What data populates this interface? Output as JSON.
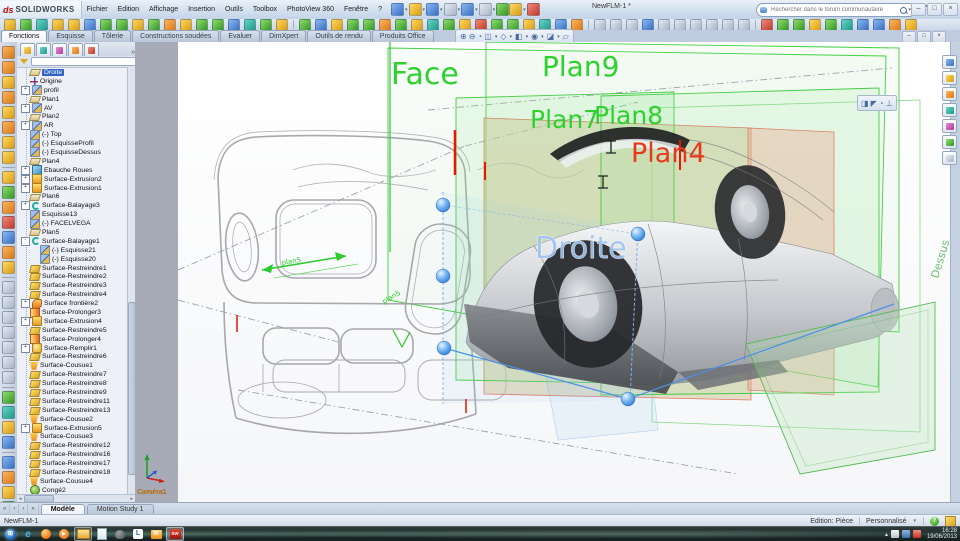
{
  "window": {
    "logo_mark": "ds",
    "logo_text": "SOLIDWORKS",
    "title": "NewFLM-1 *",
    "search_placeholder": "Rechercher dans le forum communautaire",
    "help_label": "?",
    "controls": {
      "minimize": "–",
      "restore": "□",
      "close": "×"
    }
  },
  "ui": {
    "dropdown_arrow": "▾",
    "tree_more": "»",
    "hscroll_left": "◂",
    "hscroll_right": "▸"
  },
  "menus": [
    "Fichier",
    "Edition",
    "Affichage",
    "Insertion",
    "Outils",
    "Toolbox",
    "PhotoView 360",
    "Fenêtre",
    "?"
  ],
  "command_tabs": [
    {
      "label": "Fonctions",
      "active": true
    },
    {
      "label": "Esquisse",
      "active": false
    },
    {
      "label": "Tôlerie",
      "active": false
    },
    {
      "label": "Constructions soudées",
      "active": false
    },
    {
      "label": "Evaluer",
      "active": false
    },
    {
      "label": "DimXpert",
      "active": false
    },
    {
      "label": "Outils de rendu",
      "active": false
    },
    {
      "label": "Produits Office",
      "active": false
    }
  ],
  "palettes": {
    "y": [
      "#ffd95e",
      "#d89b17"
    ],
    "g": [
      "#8fdc6a",
      "#35962a"
    ],
    "t": [
      "#66d3c4",
      "#1f9a8a"
    ],
    "b": [
      "#86b7f2",
      "#3c6fc0"
    ],
    "o": [
      "#ffb45e",
      "#d87a17"
    ],
    "r": [
      "#f08a7a",
      "#c03a2a"
    ],
    "u": [
      "#e3e9f1",
      "#a9b6c6"
    ],
    "m": [
      "#e88ad0",
      "#b03a9a"
    ]
  },
  "toolbars": {
    "quick": [
      {
        "n": "new-document-button",
        "p": "b",
        "dd": true
      },
      {
        "n": "open-button",
        "p": "y",
        "dd": true
      },
      {
        "n": "save-button",
        "p": "b",
        "dd": true
      },
      {
        "n": "print-button",
        "p": "u",
        "dd": true
      },
      {
        "n": "undo-button",
        "p": "b",
        "dd": true
      },
      {
        "n": "select-button",
        "p": "u",
        "dd": true
      },
      {
        "n": "rebuild-button",
        "p": "g",
        "dd": false
      },
      {
        "n": "options-button",
        "p": "y",
        "dd": true
      },
      {
        "n": "appearance-button",
        "p": "r",
        "dd": false
      }
    ],
    "main": "ygtyybggygoyggbtgy|gbyggogytgyrggytbo|uuubuuuuuu|rggygtbboy",
    "left": "ooyoyoyy|ygorboy|uuuuuuu|gtyb|boyg"
  },
  "headsup": [
    {
      "n": "zoom-fit-icon",
      "g": "⊕",
      "dd": false
    },
    {
      "n": "zoom-area-icon",
      "g": "⊖",
      "dd": false
    },
    {
      "n": "previous-view-icon",
      "g": "◔",
      "dd": false
    },
    {
      "n": "section-view-icon",
      "g": "◫",
      "dd": true
    },
    {
      "n": "view-orientation-icon",
      "g": "◇",
      "dd": true
    },
    {
      "n": "display-style-icon",
      "g": "◧",
      "dd": true
    },
    {
      "n": "hide-show-icon",
      "g": "◉",
      "dd": true
    },
    {
      "n": "appearance-icon",
      "g": "◪",
      "dd": true
    },
    {
      "n": "scene-icon",
      "g": "▱",
      "dd": false
    }
  ],
  "mini_toolbar": [
    {
      "n": "appearance-icon",
      "g": "◨"
    },
    {
      "n": "edit-sketch-icon",
      "g": "◤"
    },
    {
      "n": "hide-icon",
      "g": "◔"
    },
    {
      "n": "normal-to-icon",
      "g": "⊥"
    }
  ],
  "tree": {
    "tabs": [
      {
        "n": "featuremanager-tab",
        "p": "y"
      },
      {
        "n": "propertymanager-tab",
        "p": "t"
      },
      {
        "n": "configurationmanager-tab",
        "p": "m"
      },
      {
        "n": "dimxpertmanager-tab",
        "p": "o"
      },
      {
        "n": "displaymanager-tab",
        "p": "r"
      }
    ],
    "items": [
      {
        "l": "Droite",
        "i": "plane",
        "s": true
      },
      {
        "l": "Origine",
        "i": "origin"
      },
      {
        "l": "profil",
        "i": "sketch",
        "e": "+"
      },
      {
        "l": "Plan1",
        "i": "plane"
      },
      {
        "l": "AV",
        "i": "sketch",
        "e": "+"
      },
      {
        "l": "Plan2",
        "i": "plane"
      },
      {
        "l": "AR",
        "i": "sketch",
        "e": "+"
      },
      {
        "l": "(-) Top",
        "i": "sketch"
      },
      {
        "l": "(-) EsquisseProfil",
        "i": "sketch"
      },
      {
        "l": "(-) EsquisseDessus",
        "i": "sketch"
      },
      {
        "l": "Plan4",
        "i": "plane"
      },
      {
        "l": "Ebauche Roues",
        "i": "body",
        "e": "+"
      },
      {
        "l": "Surface-Extrusion2",
        "i": "extrude",
        "e": "+"
      },
      {
        "l": "Surface-Extrusion1",
        "i": "extrude",
        "e": "+"
      },
      {
        "l": "Plan6",
        "i": "plane"
      },
      {
        "l": "Surface-Balayage3",
        "i": "sweep",
        "e": "+"
      },
      {
        "l": "Esquisse13",
        "i": "sketch"
      },
      {
        "l": "(-) FACELVEGA",
        "i": "sketch"
      },
      {
        "l": "Plan5",
        "i": "plane"
      },
      {
        "l": "Surface-Balayage1",
        "i": "sweep",
        "e": "-"
      },
      {
        "l": "(-) Esquisse21",
        "i": "sketch",
        "d": 1
      },
      {
        "l": "(-) Esquisse20",
        "i": "sketch",
        "d": 1
      },
      {
        "l": "Surface-Restreindre1",
        "i": "trim"
      },
      {
        "l": "Surface-Restreindre2",
        "i": "trim"
      },
      {
        "l": "Surface-Restreindre3",
        "i": "trim"
      },
      {
        "l": "Surface-Restreindre4",
        "i": "trim"
      },
      {
        "l": "Surface frontière2",
        "i": "boundary",
        "e": "+"
      },
      {
        "l": "Surface-Prolonger3",
        "i": "extend"
      },
      {
        "l": "Surface-Extrusion4",
        "i": "extrude",
        "e": "+"
      },
      {
        "l": "Surface-Restreindre5",
        "i": "trim"
      },
      {
        "l": "Surface-Prolonger4",
        "i": "extend"
      },
      {
        "l": "Surface-Remplir1",
        "i": "fill",
        "e": "+"
      },
      {
        "l": "Surface-Restreindre6",
        "i": "trim"
      },
      {
        "l": "Surface-Cousue1",
        "i": "knit"
      },
      {
        "l": "Surface-Restreindre7",
        "i": "trim"
      },
      {
        "l": "Surface-Restreindre8",
        "i": "trim"
      },
      {
        "l": "Surface-Restreindre9",
        "i": "trim"
      },
      {
        "l": "Surface-Restreindre11",
        "i": "trim"
      },
      {
        "l": "Surface-Restreindre13",
        "i": "trim"
      },
      {
        "l": "Surface-Cousue2",
        "i": "knit"
      },
      {
        "l": "Surface-Extrusion5",
        "i": "extrude",
        "e": "+"
      },
      {
        "l": "Surface-Cousue3",
        "i": "knit"
      },
      {
        "l": "Surface-Restreindre12",
        "i": "trim"
      },
      {
        "l": "Surface-Restreindre16",
        "i": "trim"
      },
      {
        "l": "Surface-Restreindre17",
        "i": "trim"
      },
      {
        "l": "Surface-Restreindre18",
        "i": "trim"
      },
      {
        "l": "Surface-Cousue4",
        "i": "knit"
      },
      {
        "l": "Congé2",
        "i": "fillet"
      }
    ]
  },
  "right_pane": [
    {
      "n": "resources-icon",
      "p": "b"
    },
    {
      "n": "design-library-icon",
      "p": "y"
    },
    {
      "n": "file-explorer-icon",
      "p": "o"
    },
    {
      "n": "palette-icon",
      "p": "t"
    },
    {
      "n": "appearances-icon",
      "p": "m"
    },
    {
      "n": "scene-icon",
      "p": "g"
    },
    {
      "n": "custom-properties-icon",
      "p": "u"
    }
  ],
  "viewport": {
    "labels": {
      "face": "Face",
      "plan9": "Plan9",
      "plan7": "Plan7",
      "plan8": "Plan8",
      "plan4": "Plan4",
      "droite": "Droite",
      "dessus": "Dessus",
      "plan5_a": "plan5",
      "plan5_b": "plan5",
      "camera": "Caméra1"
    },
    "colors": {
      "plane_green": "#2ed12e",
      "plan4_red": "#e8381c",
      "droite_blue": "#9fc4ef",
      "camera_orange": "#b86a00",
      "selection_blue": "#2f63c4"
    }
  },
  "doc_tabs": {
    "nav": [
      "«",
      "‹",
      "›",
      "»"
    ],
    "tabs": [
      {
        "label": "Modèle",
        "active": true
      },
      {
        "label": "Motion Study 1",
        "active": false
      }
    ]
  },
  "status": {
    "left_label": "NewFLM-1",
    "edition": "Edition: Pièce",
    "display_mode": "Personnalisé",
    "help_glyph": "?"
  },
  "taskbar": {
    "icons": [
      {
        "n": "start-button",
        "g": "⊞"
      },
      {
        "n": "internet-explorer",
        "g": "e"
      },
      {
        "n": "firefox",
        "g": ""
      },
      {
        "n": "media-player",
        "g": "▶"
      },
      {
        "n": "windows-explorer",
        "g": "",
        "boxed": true
      },
      {
        "n": "notepad",
        "g": ""
      },
      {
        "n": "gimp",
        "g": ""
      },
      {
        "n": "translator",
        "g": "L"
      },
      {
        "n": "outlook",
        "g": "✉"
      },
      {
        "n": "solidworks",
        "g": "SW",
        "boxed": true,
        "active": true
      }
    ],
    "tray_caret": "▴",
    "clock": {
      "time": "16:28",
      "date": "19/06/2013"
    }
  }
}
